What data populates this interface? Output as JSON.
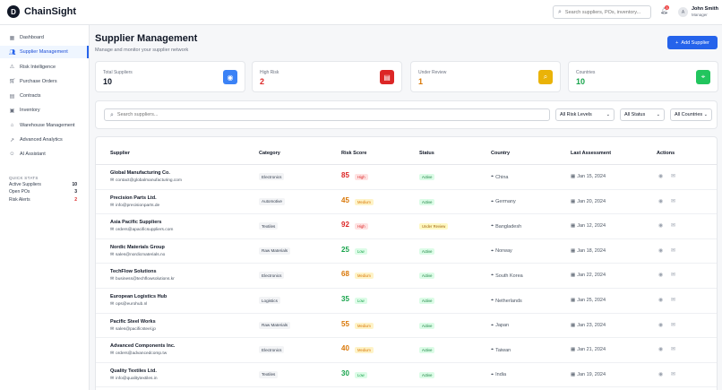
{
  "app": {
    "logo_letter": "D",
    "name": "ChainSight"
  },
  "header": {
    "search_placeholder": "Search suppliers, POs, inventory...",
    "notifications_count": "3",
    "user": {
      "initial": "A",
      "name": "John Smith",
      "role": "Manager"
    }
  },
  "sidebar": {
    "items": [
      {
        "label": "Dashboard",
        "icon": "dashboard-icon",
        "active": false
      },
      {
        "label": "Supplier Management",
        "icon": "users-icon",
        "active": true
      },
      {
        "label": "Risk Intelligence",
        "icon": "warning-icon",
        "active": false
      },
      {
        "label": "Purchase Orders",
        "icon": "cart-icon",
        "active": false
      },
      {
        "label": "Contracts",
        "icon": "document-icon",
        "active": false
      },
      {
        "label": "Inventory",
        "icon": "box-icon",
        "active": false
      },
      {
        "label": "Warehouse Management",
        "icon": "warehouse-icon",
        "active": false
      },
      {
        "label": "Advanced Analytics",
        "icon": "trend-icon",
        "active": false
      },
      {
        "label": "AI Assistant",
        "icon": "robot-icon",
        "active": false
      }
    ],
    "quick_stats": {
      "title": "QUICK STATS",
      "rows": [
        {
          "label": "Active Suppliers",
          "value": "10",
          "color": "#111827"
        },
        {
          "label": "Open POs",
          "value": "3",
          "color": "#111827"
        },
        {
          "label": "Risk Alerts",
          "value": "2",
          "color": "#dc2626"
        }
      ]
    }
  },
  "page": {
    "title": "Supplier Management",
    "subtitle": "Manage and monitor your supplier network",
    "add_button": "Add Supplier"
  },
  "stats": [
    {
      "label": "Total Suppliers",
      "value": "10",
      "value_color": "#111827",
      "icon": "eye-icon",
      "icon_bg": "#3b82f6"
    },
    {
      "label": "High Risk",
      "value": "2",
      "value_color": "#dc2626",
      "icon": "document-icon",
      "icon_bg": "#dc2626"
    },
    {
      "label": "Under Review",
      "value": "1",
      "value_color": "#d97706",
      "icon": "search-icon",
      "icon_bg": "#eab308"
    },
    {
      "label": "Countries",
      "value": "10",
      "value_color": "#16a34a",
      "icon": "location-icon",
      "icon_bg": "#22c55e"
    }
  ],
  "filters": {
    "search_placeholder": "Search suppliers...",
    "risk": "All Risk Levels",
    "status": "All Status",
    "country": "All Countries"
  },
  "table": {
    "columns": [
      "Supplier",
      "Category",
      "Risk Score",
      "Status",
      "Country",
      "Last Assessment",
      "Actions"
    ],
    "rows": [
      {
        "name": "Global Manufacturing Co.",
        "email": "contact@globalmanufacturing.com",
        "category": "Electronics",
        "score": "85",
        "risk": "High",
        "status": "Active",
        "country": "China",
        "date": "Jan 15, 2024"
      },
      {
        "name": "Precision Parts Ltd.",
        "email": "info@precisionparts.de",
        "category": "Automotive",
        "score": "45",
        "risk": "Medium",
        "status": "Active",
        "country": "Germany",
        "date": "Jan 20, 2024"
      },
      {
        "name": "Asia Pacific Suppliers",
        "email": "orders@apacificsuppliers.com",
        "category": "Textiles",
        "score": "92",
        "risk": "High",
        "status": "Under Review",
        "country": "Bangladesh",
        "date": "Jan 12, 2024"
      },
      {
        "name": "Nordic Materials Group",
        "email": "sales@nordicmaterials.no",
        "category": "Raw Materials",
        "score": "25",
        "risk": "Low",
        "status": "Active",
        "country": "Norway",
        "date": "Jan 18, 2024"
      },
      {
        "name": "TechFlow Solutions",
        "email": "business@techflowsolutions.kr",
        "category": "Electronics",
        "score": "68",
        "risk": "Medium",
        "status": "Active",
        "country": "South Korea",
        "date": "Jan 22, 2024"
      },
      {
        "name": "European Logistics Hub",
        "email": "ops@eurohub.nl",
        "category": "Logistics",
        "score": "35",
        "risk": "Low",
        "status": "Active",
        "country": "Netherlands",
        "date": "Jan 25, 2024"
      },
      {
        "name": "Pacific Steel Works",
        "email": "sales@pacificsteel.jp",
        "category": "Raw Materials",
        "score": "55",
        "risk": "Medium",
        "status": "Active",
        "country": "Japan",
        "date": "Jan 23, 2024"
      },
      {
        "name": "Advanced Components Inc.",
        "email": "orders@advancedcomp.tw",
        "category": "Electronics",
        "score": "40",
        "risk": "Medium",
        "status": "Active",
        "country": "Taiwan",
        "date": "Jan 21, 2024"
      },
      {
        "name": "Quality Textiles Ltd.",
        "email": "info@qualitytextiles.in",
        "category": "Textiles",
        "score": "30",
        "risk": "Low",
        "status": "Active",
        "country": "India",
        "date": "Jan 19, 2024"
      }
    ]
  },
  "colors": {
    "accent": "#2563eb",
    "risk_high": "#dc2626",
    "risk_medium": "#d97706",
    "risk_low": "#16a34a"
  }
}
